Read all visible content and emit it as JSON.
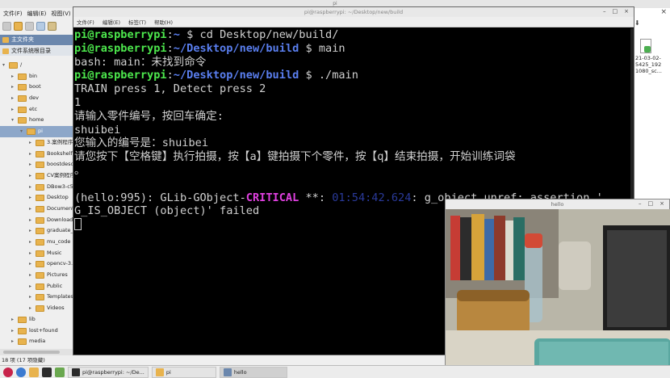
{
  "file_manager": {
    "title": "pi",
    "menu": [
      "文件(F)",
      "编辑(E)",
      "视图(V)"
    ],
    "side_panel_title": "主文件夹",
    "side_panel_mode": "文件系统根目录",
    "tree": [
      {
        "label": "/",
        "depth": 0,
        "expanded": true
      },
      {
        "label": "bin",
        "depth": 1
      },
      {
        "label": "boot",
        "depth": 1
      },
      {
        "label": "dev",
        "depth": 1
      },
      {
        "label": "etc",
        "depth": 1
      },
      {
        "label": "home",
        "depth": 1,
        "expanded": true
      },
      {
        "label": "pi",
        "depth": 2,
        "expanded": true,
        "selected": true
      },
      {
        "label": "3.案例程序",
        "depth": 3
      },
      {
        "label": "Bookshelf",
        "depth": 3
      },
      {
        "label": "boostdesc_bgm...",
        "depth": 3
      },
      {
        "label": "CV案例程序",
        "depth": 3
      },
      {
        "label": "DBow3-c5ae539...",
        "depth": 3
      },
      {
        "label": "Desktop",
        "depth": 3
      },
      {
        "label": "Documents",
        "depth": 3
      },
      {
        "label": "Downloads",
        "depth": 3
      },
      {
        "label": "graduate_sift_pic...",
        "depth": 3
      },
      {
        "label": "mu_code",
        "depth": 3
      },
      {
        "label": "Music",
        "depth": 3
      },
      {
        "label": "opencv-3.4.13",
        "depth": 3
      },
      {
        "label": "Pictures",
        "depth": 3
      },
      {
        "label": "Public",
        "depth": 3
      },
      {
        "label": "Templates",
        "depth": 3
      },
      {
        "label": "Videos",
        "depth": 3
      },
      {
        "label": "lib",
        "depth": 1
      },
      {
        "label": "lost+found",
        "depth": 1
      },
      {
        "label": "media",
        "depth": 1
      }
    ],
    "status": "18 项 (17 项隐藏)",
    "right_file_name": "21-03-02-5425_192 1080_sc..."
  },
  "terminal": {
    "title": "pi@raspberrypi: ~/Desktop/new/build",
    "menu": [
      "文件(F)",
      "编辑(E)",
      "标签(T)",
      "帮助(H)"
    ],
    "prompt_user": "pi@raspberrypi",
    "line1_path": "~",
    "line1_cmd": " cd Desktop/new/build/",
    "line2_path": "~/Desktop/new/build",
    "line2_cmd": " main",
    "line3": "bash: main：未找到命令",
    "line4_path": "~/Desktop/new/build",
    "line4_cmd": " ./main",
    "line5": "TRAIN press 1, Detect press 2",
    "line6": "1",
    "line7": "请输入零件编号，按回车确定:",
    "line8": "shuibei",
    "line9": "您输入的编号是：shuibei",
    "line10": "请您按下【空格键】执行拍摄，按【a】键拍摄下个零件，按【q】结束拍摄，开始训练词袋",
    "line11": "。",
    "line12_pre": "(hello:995): GLib-GObject-",
    "line12_crit": "CRITICAL",
    "line12_mid": " **: ",
    "line12_time": "01:54:42.624",
    "line12_post": ": g_object_unref: assertion '",
    "line13": "G_IS_OBJECT (object)' failed"
  },
  "camera_window": {
    "title": "hello"
  },
  "taskbar": {
    "tasks": [
      {
        "label": "pi@raspberrypi: ~/De..."
      },
      {
        "label": "pi"
      },
      {
        "label": "hello"
      }
    ]
  }
}
